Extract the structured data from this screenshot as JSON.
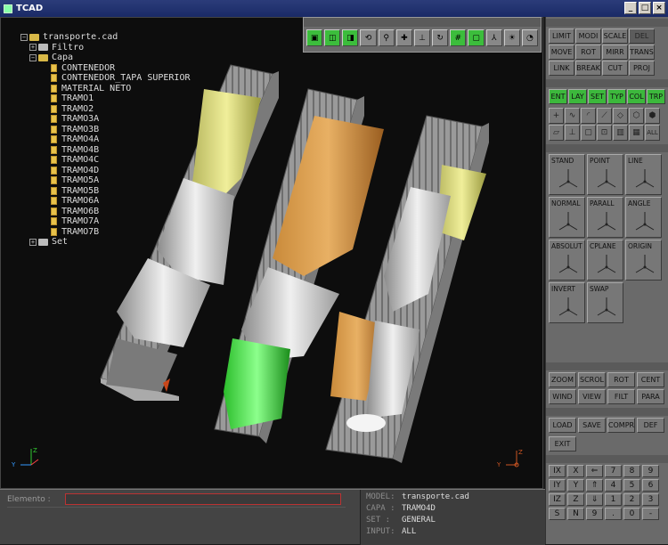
{
  "window": {
    "title": "TCAD"
  },
  "tree": {
    "root": "transporte.cad",
    "filtro": "Filtro",
    "capa": "Capa",
    "items": [
      "CONTENEDOR",
      "CONTENEDOR_TAPA SUPERIOR",
      "MATERIAL NETO",
      "TRAMO1",
      "TRAMO2",
      "TRAMO3A",
      "TRAMO3B",
      "TRAMO4A",
      "TRAMO4B",
      "TRAMO4C",
      "TRAMO4D",
      "TRAMO5A",
      "TRAMO5B",
      "TRAMO6A",
      "TRAMO6B",
      "TRAMO7A",
      "TRAMO7B"
    ],
    "set": "Set"
  },
  "edit_buttons": [
    "LIMIT",
    "MODI",
    "SCALE",
    "DEL",
    "MOVE",
    "ROT",
    "MIRR",
    "TRANS",
    "LINK",
    "BREAK",
    "CUT",
    "PROJ"
  ],
  "select_buttons": [
    "ENT",
    "LAY",
    "SET",
    "TYP",
    "COL",
    "TRP"
  ],
  "big_buttons": [
    "STAND",
    "POINT",
    "LINE",
    "NORMAL",
    "PARALL",
    "ANGLE",
    "ABSOLUT",
    "CPLANE",
    "ORIGIN",
    "INVERT",
    "SWAP"
  ],
  "view_buttons": [
    "ZOOM",
    "SCROL",
    "ROT",
    "CENT",
    "WIND",
    "VIEW",
    "FILT",
    "PARA"
  ],
  "file_buttons": [
    "LOAD",
    "SAVE",
    "COMPR",
    "DEF"
  ],
  "exit_button": "EXIT",
  "numpad": [
    "IX",
    "X",
    "⇐",
    "7",
    "8",
    "9",
    "IY",
    "Y",
    "⇑",
    "4",
    "5",
    "6",
    "IZ",
    "Z",
    "⇓",
    "1",
    "2",
    "3",
    "S",
    "N",
    "9",
    ".",
    "0",
    "-"
  ],
  "bottom": {
    "elemento_label": "Elemento :"
  },
  "info": {
    "model_label": "MODEL:",
    "model": "transporte.cad",
    "capa_label": "CAPA :",
    "capa": "TRAMO4D",
    "set_label": "SET  :",
    "set": "GENERAL",
    "input_label": "INPUT:",
    "input": "ALL"
  },
  "colors": {
    "accent_green": "#3cb83c",
    "panel": "#6a6a6a",
    "viewport": "#0d0d0d"
  }
}
